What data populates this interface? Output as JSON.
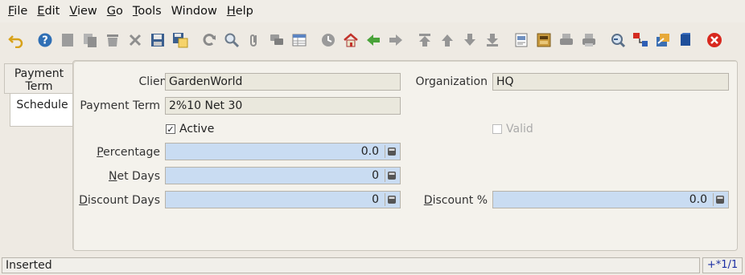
{
  "menu": [
    {
      "label": "File",
      "underline_idx": 0
    },
    {
      "label": "Edit",
      "underline_idx": 0
    },
    {
      "label": "View",
      "underline_idx": 0
    },
    {
      "label": "Go",
      "underline_idx": 0
    },
    {
      "label": "Tools",
      "underline_idx": 0
    },
    {
      "label": "Window",
      "underline_idx": -1
    },
    {
      "label": "Help",
      "underline_idx": 0
    }
  ],
  "toolbar_icons": [
    "undo-icon",
    "help-icon",
    "new-icon",
    "copy-icon",
    "delete-icon",
    "delete-selection-icon",
    "save-icon",
    "save-new-icon",
    "refresh-icon",
    "find-icon",
    "attachment-icon",
    "chat-icon",
    "grid-toggle-icon",
    "history-icon",
    "home-icon",
    "back-icon",
    "forward-icon",
    "first-record-icon",
    "previous-record-icon",
    "next-record-icon",
    "last-record-icon",
    "report-icon",
    "archive-icon",
    "print-preview-icon",
    "print-icon",
    "zoom-across-icon",
    "request-icon",
    "product-info-icon",
    "workflow-icon",
    "exit-icon"
  ],
  "tabs": [
    {
      "label": "Payment Term",
      "active": false
    },
    {
      "label": "Schedule",
      "active": true
    }
  ],
  "form": {
    "client_label": "Client",
    "client_value": "GardenWorld",
    "organization_label": "Organization",
    "organization_value": "HQ",
    "payment_term_label": "Payment Term",
    "payment_term_value": "2%10 Net 30",
    "active_label": "Active",
    "active_checked": true,
    "valid_label": "Valid",
    "valid_checked": false,
    "percentage_label": "Percentage",
    "percentage_value": "0.0",
    "net_days_label": "Net Days",
    "net_days_value": "0",
    "discount_days_label": "Discount Days",
    "discount_days_value": "0",
    "discount_pct_label": "Discount %",
    "discount_pct_value": "0.0"
  },
  "status": {
    "message": "Inserted",
    "record_info": "+*1/1"
  },
  "colors": {
    "mandatory_field": "#c9dcf2",
    "readonly_field": "#eae8dd",
    "record_info_text": "#1b2ea3"
  }
}
